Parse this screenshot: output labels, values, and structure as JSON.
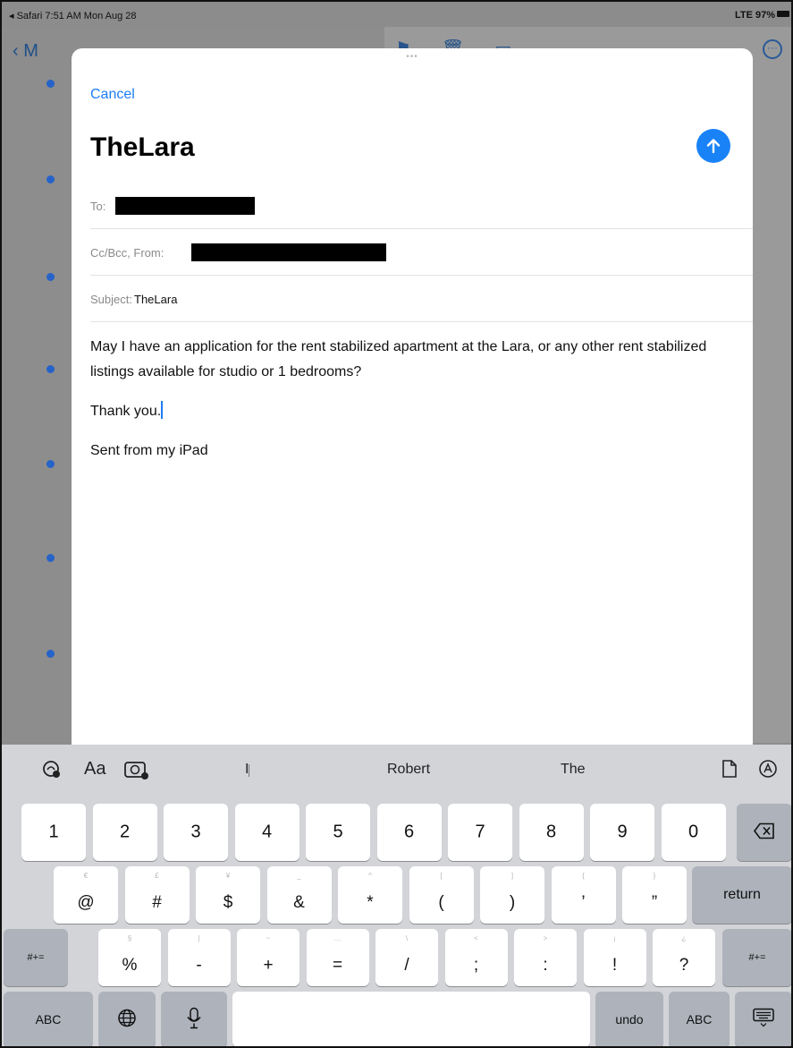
{
  "status_bar": {
    "back_app": "◂ Safari",
    "time_date": "7:51 AM  Mon Aug 28",
    "signal_battery": "LTE 97%"
  },
  "background": {
    "back_label": "‹ M"
  },
  "compose": {
    "cancel_label": "Cancel",
    "title": "TheLara",
    "to_label": "To:",
    "cc_label": "Cc/Bcc, From:",
    "subject_label": "Subject:",
    "subject_value": "TheLara",
    "body_line1": "May I have an application for the rent stabilized apartment at the Lara, or any other rent stabilized listings available for studio or 1 bedrooms?",
    "body_line2": "Thank you.",
    "signature": "Sent from my iPad"
  },
  "keyboard": {
    "toolbar": {
      "format_label": "Aa",
      "suggestions": [
        "I",
        "Robert",
        "The"
      ]
    },
    "row1": [
      "1",
      "2",
      "3",
      "4",
      "5",
      "6",
      "7",
      "8",
      "9",
      "0"
    ],
    "row2": [
      {
        "main": "@",
        "hint": "€"
      },
      {
        "main": "#",
        "hint": "£"
      },
      {
        "main": "$",
        "hint": "¥"
      },
      {
        "main": "&",
        "hint": "_"
      },
      {
        "main": "*",
        "hint": "^"
      },
      {
        "main": "(",
        "hint": "["
      },
      {
        "main": ")",
        "hint": "]"
      },
      {
        "main": "’",
        "hint": "{"
      },
      {
        "main": "”",
        "hint": "}"
      }
    ],
    "row3": [
      {
        "main": "%",
        "hint": "§"
      },
      {
        "main": "-",
        "hint": "|"
      },
      {
        "main": "+",
        "hint": "~"
      },
      {
        "main": "=",
        "hint": "…"
      },
      {
        "main": "/",
        "hint": "\\"
      },
      {
        "main": ";",
        "hint": "<"
      },
      {
        "main": ":",
        "hint": ">"
      },
      {
        "main": "!",
        "hint": "¡"
      },
      {
        "main": "?",
        "hint": "¿"
      }
    ],
    "return_label": "return",
    "symbols_label": "#+=",
    "abc_label": "ABC",
    "undo_label": "undo"
  }
}
